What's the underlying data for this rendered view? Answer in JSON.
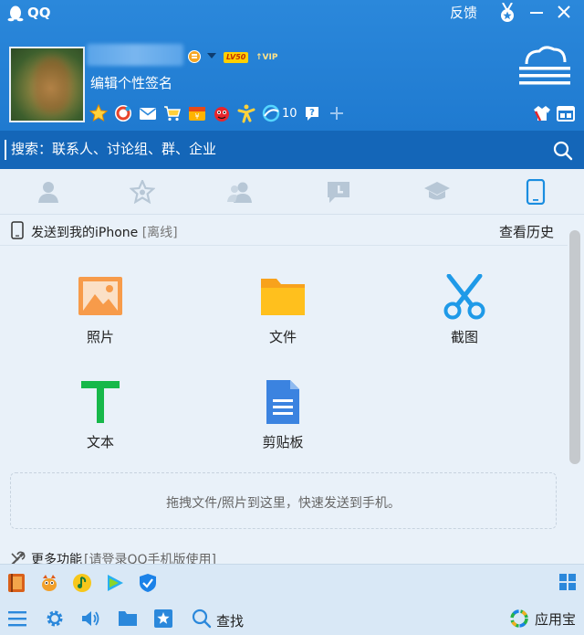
{
  "window": {
    "title": "QQ",
    "feedback_label": "反馈"
  },
  "profile": {
    "signature": "编辑个性签名",
    "level_badge": "LV50",
    "vip_badge": "VIP",
    "plugin_count": "10"
  },
  "search": {
    "placeholder": "搜索：联系人、讨论组、群、企业"
  },
  "device": {
    "title": "发送到我的iPhone",
    "status": "[离线]",
    "history_label": "查看历史"
  },
  "features": {
    "photo": "照片",
    "file": "文件",
    "screenshot": "截图",
    "text": "文本",
    "clipboard": "剪贴板"
  },
  "drop_zone": {
    "text": "拖拽文件/照片到这里，快速发送到手机。"
  },
  "more": {
    "label": "更多功能",
    "hint": "[请登录QQ手机版使用]"
  },
  "bottom": {
    "find_label": "查找",
    "appstore_label": "应用宝"
  },
  "colors": {
    "header_blue": "#2283d8",
    "search_blue": "#1466b8",
    "panel_bg": "#e9f1f9",
    "active_tab": "#1a8de0",
    "inactive_tab": "#b7c7d6"
  }
}
